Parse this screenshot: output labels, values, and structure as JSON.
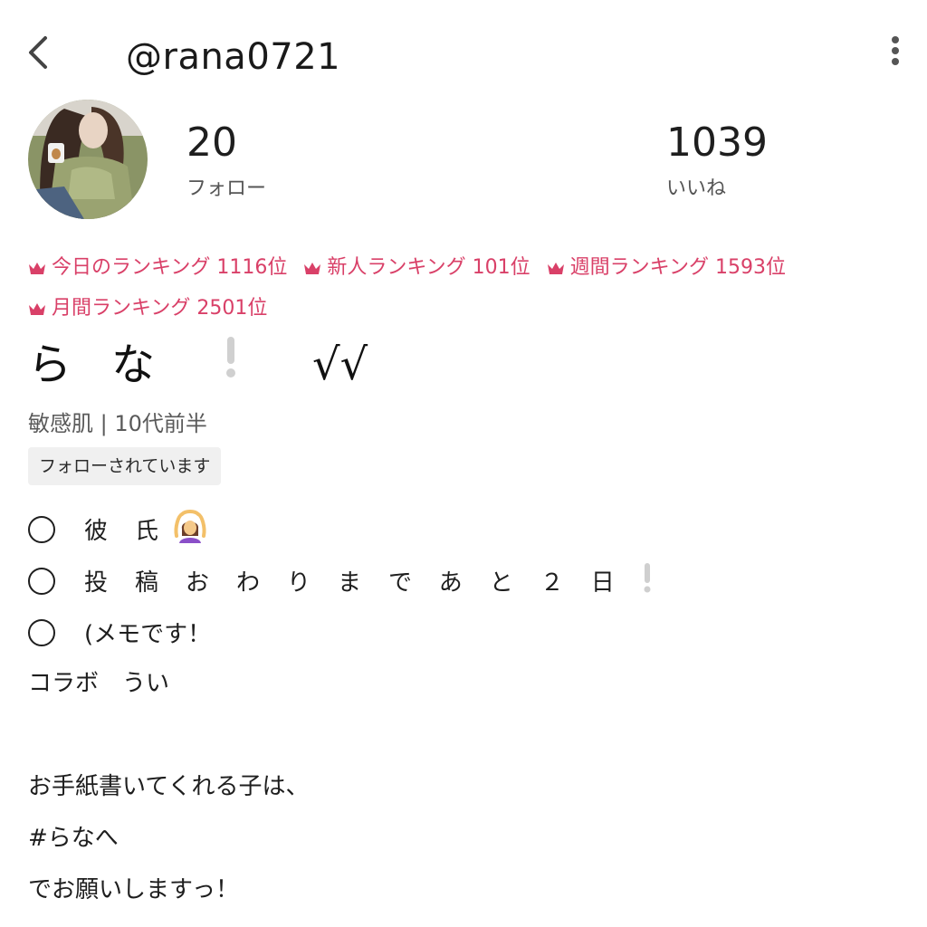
{
  "header": {
    "username": "@rana0721",
    "back_icon": "chevron-left-icon",
    "more_icon": "more-vertical-icon"
  },
  "profile": {
    "stats": [
      {
        "value": "20",
        "label": "フォロー"
      },
      {
        "value": "",
        "label": ""
      },
      {
        "value": "1039",
        "label": "いいね"
      }
    ],
    "rankings": [
      {
        "label": "今日のランキング 1116位"
      },
      {
        "label": "新人ランキング 101位"
      },
      {
        "label": "週間ランキング 1593位"
      },
      {
        "label": "月間ランキング 2501位"
      }
    ],
    "display_name": {
      "chars": "らな",
      "suffix": "√√"
    },
    "meta": "敏感肌 | 10代前半",
    "follow_status": "フォローされています"
  },
  "bio": {
    "todos": [
      {
        "text": "彼氏"
      },
      {
        "text": "投稿おわりまであと２日"
      },
      {
        "text": "(メモです！"
      }
    ],
    "lines": [
      "コラボ　うい",
      "",
      "お手紙書いてくれる子は、",
      "#らなへ",
      "でお願いしますっ！"
    ]
  },
  "colors": {
    "accent": "#d94068",
    "text": "#1e1e1e",
    "muted": "#5a5a5a",
    "badge_bg": "#f0f0f0"
  }
}
